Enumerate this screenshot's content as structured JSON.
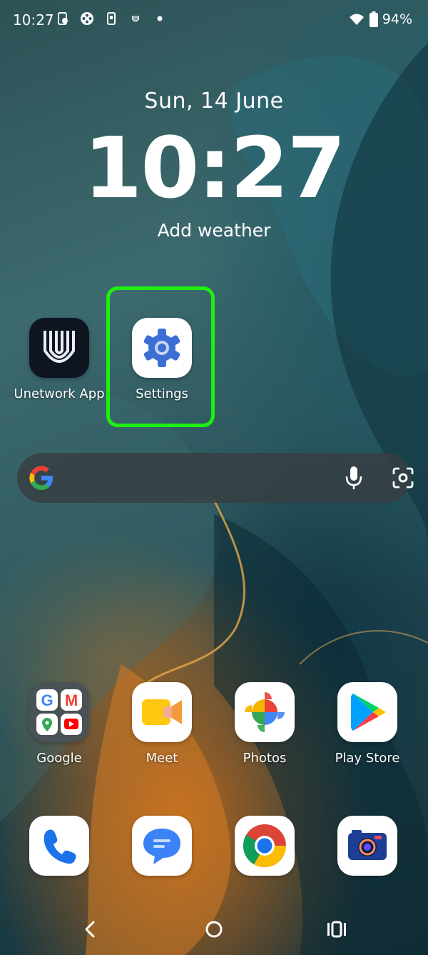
{
  "status_bar": {
    "time": "10:27",
    "battery_percent": "94%",
    "icons": [
      "screen-record-icon",
      "game-controller-icon",
      "phone-device-icon",
      "unetwork-notif-icon",
      "dot-icon",
      "wifi-icon",
      "battery-icon"
    ]
  },
  "clock_widget": {
    "date": "Sun, 14 June",
    "time": "10:27",
    "weather": "Add weather"
  },
  "home_apps": [
    {
      "label": "Unetwork App",
      "icon": "unetwork-icon"
    },
    {
      "label": "Settings",
      "icon": "gear-icon"
    }
  ],
  "highlight_color": "#1fef10",
  "search_bar": {
    "icons": [
      "google-g-icon",
      "mic-icon",
      "lens-icon"
    ]
  },
  "dock_row1": [
    {
      "label": "Google",
      "icon": "google-folder-icon"
    },
    {
      "label": "Meet",
      "icon": "meet-icon"
    },
    {
      "label": "Photos",
      "icon": "photos-icon"
    },
    {
      "label": "Play Store",
      "icon": "play-store-icon"
    }
  ],
  "dock_row2": [
    {
      "label": "",
      "icon": "phone-icon"
    },
    {
      "label": "",
      "icon": "messages-icon"
    },
    {
      "label": "",
      "icon": "chrome-icon"
    },
    {
      "label": "",
      "icon": "camera-icon"
    }
  ],
  "navigation": [
    "back-icon",
    "home-icon",
    "recents-icon"
  ]
}
